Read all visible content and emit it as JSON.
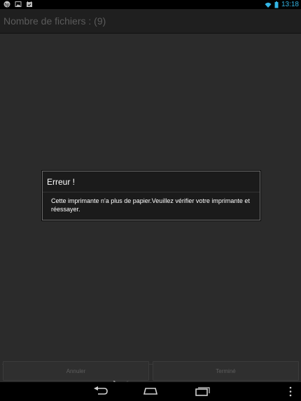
{
  "status_bar": {
    "time": "13:18"
  },
  "header": {
    "title": "Nombre de fichiers : (9)"
  },
  "dialog": {
    "title": "Erreur !",
    "message": "Cette imprimante n'a plus de papier.Veuillez vérifier votre imprimante et réessayer."
  },
  "buttons": {
    "cancel": "Annuler",
    "done": "Terminé"
  },
  "colors": {
    "accent": "#33b5e5",
    "background": "#2b2b2b"
  }
}
